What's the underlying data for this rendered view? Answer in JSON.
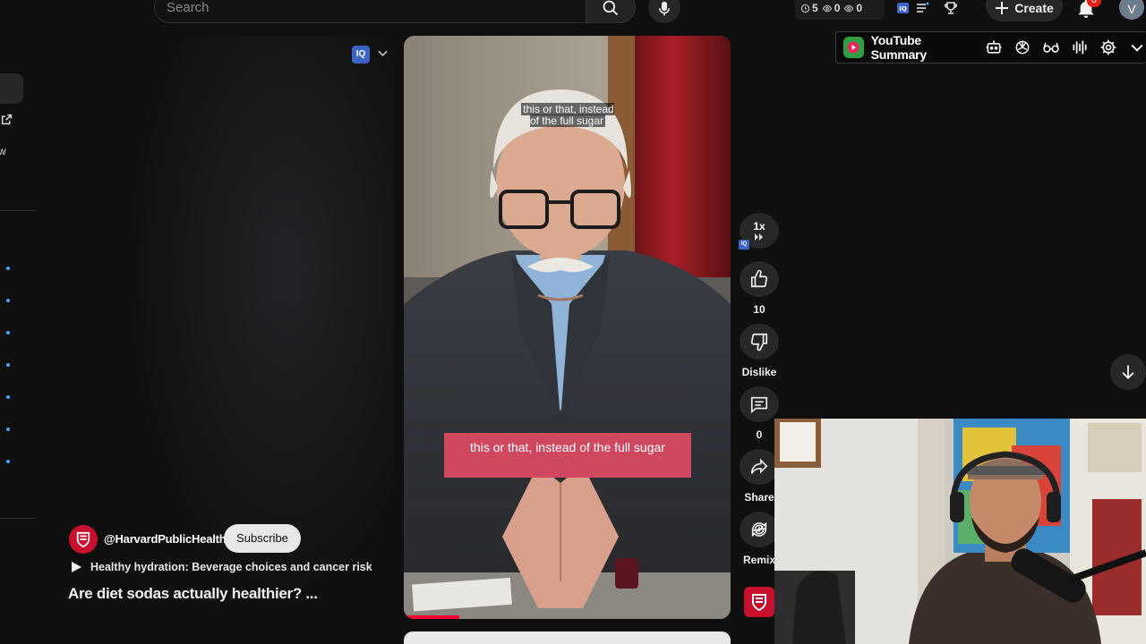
{
  "search": {
    "placeholder": "Search"
  },
  "header_stats": {
    "watch_later": "5",
    "views_a": "0",
    "views_b": "0"
  },
  "header": {
    "create_label": "Create",
    "notification_count": "8",
    "avatar_initial": "V"
  },
  "extension": {
    "title": "YouTube Summary",
    "logo_color": "#2ea043",
    "icons": [
      "robot-icon",
      "chatgpt-icon",
      "glasses-icon",
      "audio-wave-icon",
      "settings-icon",
      "chevron-down-icon"
    ]
  },
  "sidebar": {
    "partial_text": "w"
  },
  "iq_button": {
    "label": "IQ"
  },
  "video": {
    "caption_top": "this or that, instead of the full sugar",
    "caption_banner": "this or that, instead of the full sugar",
    "progress": 0.17
  },
  "actions": {
    "speed": "1x",
    "likes": "10",
    "dislike_label": "Dislike",
    "comments": "0",
    "share_label": "Share",
    "remix_label": "Remix"
  },
  "channel": {
    "handle": "@HarvardPublicHealth",
    "subscribe_label": "Subscribe",
    "avatar_color": "#c8102e"
  },
  "playlist": {
    "title": "Healthy hydration: Beverage choices and cancer risk"
  },
  "short": {
    "title": "Are diet sodas actually healthier? ..."
  },
  "colors": {
    "background": "#0f0f0f",
    "caption_banner": "#cf4860",
    "accent_red": "#ff0033",
    "link_blue": "#3ea6ff"
  }
}
